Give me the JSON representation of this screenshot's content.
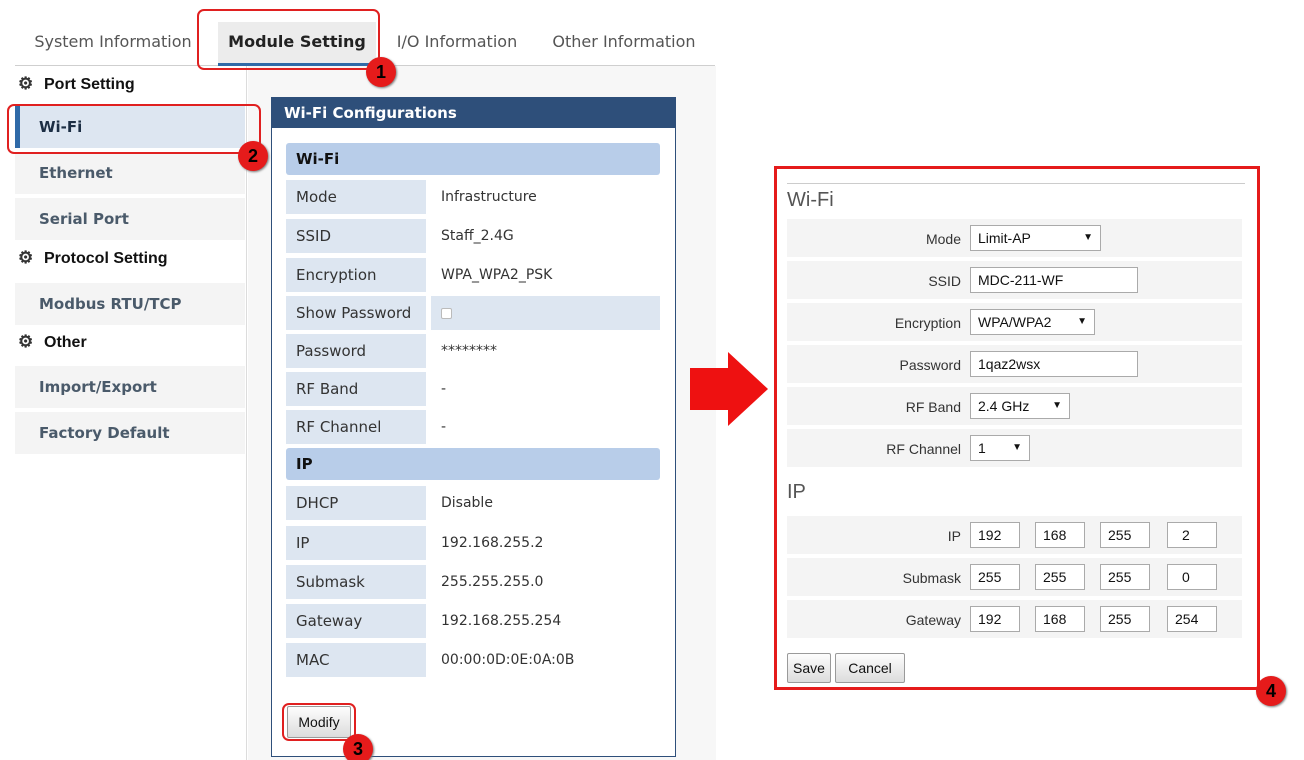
{
  "tabs": [
    {
      "label": "System Information"
    },
    {
      "label": "Module Setting"
    },
    {
      "label": "I/O Information"
    },
    {
      "label": "Other Information"
    }
  ],
  "sidebar": {
    "sections": [
      {
        "title": "Port Setting"
      },
      {
        "title": "Protocol Setting"
      },
      {
        "title": "Other"
      }
    ],
    "items": [
      {
        "label": "Wi-Fi"
      },
      {
        "label": "Ethernet"
      },
      {
        "label": "Serial Port"
      },
      {
        "label": "Modbus RTU/TCP"
      },
      {
        "label": "Import/Export"
      },
      {
        "label": "Factory Default"
      }
    ]
  },
  "panel": {
    "title": "Wi-Fi Configurations",
    "wifi_heading": "Wi-Fi",
    "ip_heading": "IP",
    "rows": [
      {
        "label": "Mode",
        "value": "Infrastructure"
      },
      {
        "label": "SSID",
        "value": "Staff_2.4G"
      },
      {
        "label": "Encryption",
        "value": "WPA_WPA2_PSK"
      },
      {
        "label": "Show Password",
        "value": ""
      },
      {
        "label": "Password",
        "value": "********"
      },
      {
        "label": "RF Band",
        "value": "-"
      },
      {
        "label": "RF Channel",
        "value": "-"
      },
      {
        "label": "DHCP",
        "value": "Disable"
      },
      {
        "label": "IP",
        "value": "192.168.255.2"
      },
      {
        "label": "Submask",
        "value": "255.255.255.0"
      },
      {
        "label": "Gateway",
        "value": "192.168.255.254"
      },
      {
        "label": "MAC",
        "value": "00:00:0D:0E:0A:0B"
      }
    ],
    "modify_label": "Modify"
  },
  "edit_form": {
    "wifi_heading": "Wi-Fi",
    "ip_heading": "IP",
    "mode": {
      "label": "Mode",
      "value": "Limit-AP"
    },
    "ssid": {
      "label": "SSID",
      "value": "MDC-211-WF"
    },
    "encryption": {
      "label": "Encryption",
      "value": "WPA/WPA2"
    },
    "password": {
      "label": "Password",
      "value": "1qaz2wsx"
    },
    "rf_band": {
      "label": "RF Band",
      "value": "2.4 GHz"
    },
    "rf_channel": {
      "label": "RF Channel",
      "value": "1"
    },
    "ip": {
      "label": "IP",
      "octets": [
        "192",
        "168",
        "255",
        "2"
      ]
    },
    "submask": {
      "label": "Submask",
      "octets": [
        "255",
        "255",
        "255",
        "0"
      ]
    },
    "gateway": {
      "label": "Gateway",
      "octets": [
        "192",
        "168",
        "255",
        "254"
      ]
    },
    "save_label": "Save",
    "cancel_label": "Cancel"
  },
  "annotations": {
    "badges": [
      "1",
      "2",
      "3",
      "4"
    ],
    "accent_color": "#e51b1b",
    "icon": "arrow-right-icon"
  },
  "colors": {
    "panel_header": "#2e4f7a",
    "group_header": "#b8cde9",
    "label_bg": "#dde6f1",
    "highlight": "#e51b1b"
  }
}
